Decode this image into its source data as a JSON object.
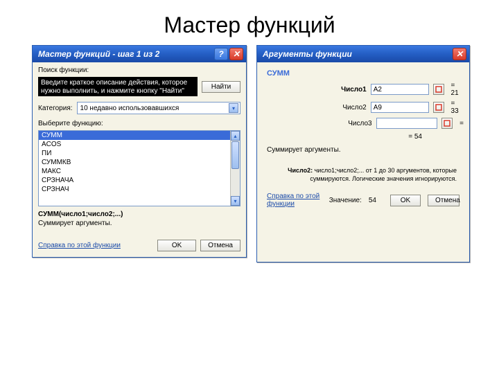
{
  "page_title": "Мастер функций",
  "left": {
    "title": "Мастер функций - шаг 1 из 2",
    "search_label": "Поиск функции:",
    "search_text": "Введите краткое описание действия, которое нужно выполнить, и нажмите кнопку \"Найти\"",
    "find_btn": "Найти",
    "category_label": "Категория:",
    "category_value": "10 недавно использовавшихся",
    "select_label": "Выберите функцию:",
    "functions": [
      "СУММ",
      "ACOS",
      "ПИ",
      "СУММКВ",
      "МАКС",
      "СРЗНАЧА",
      "СРЗНАЧ"
    ],
    "signature": "СУММ(число1;число2;...)",
    "desc": "Суммирует аргументы.",
    "help_link": "Справка по этой функции",
    "ok": "OK",
    "cancel": "Отмена"
  },
  "right": {
    "title": "Аргументы функции",
    "fn": "СУММ",
    "args": [
      {
        "label": "Число1",
        "value": "A2",
        "result": "= 21",
        "bold": true
      },
      {
        "label": "Число2",
        "value": "A9",
        "result": "= 33",
        "bold": false
      },
      {
        "label": "Число3",
        "value": "",
        "result": "=",
        "bold": false
      }
    ],
    "eq": "= 54",
    "helptext": "Суммирует аргументы.",
    "argdoc_label": "Число2:",
    "argdoc_body": "число1;число2;... от 1 до 30 аргументов, которые суммируются. Логические значения игнорируются.",
    "help_link": "Справка по этой функции",
    "result_label": "Значение:",
    "result_value": "54",
    "ok": "OK",
    "cancel": "Отмена"
  }
}
